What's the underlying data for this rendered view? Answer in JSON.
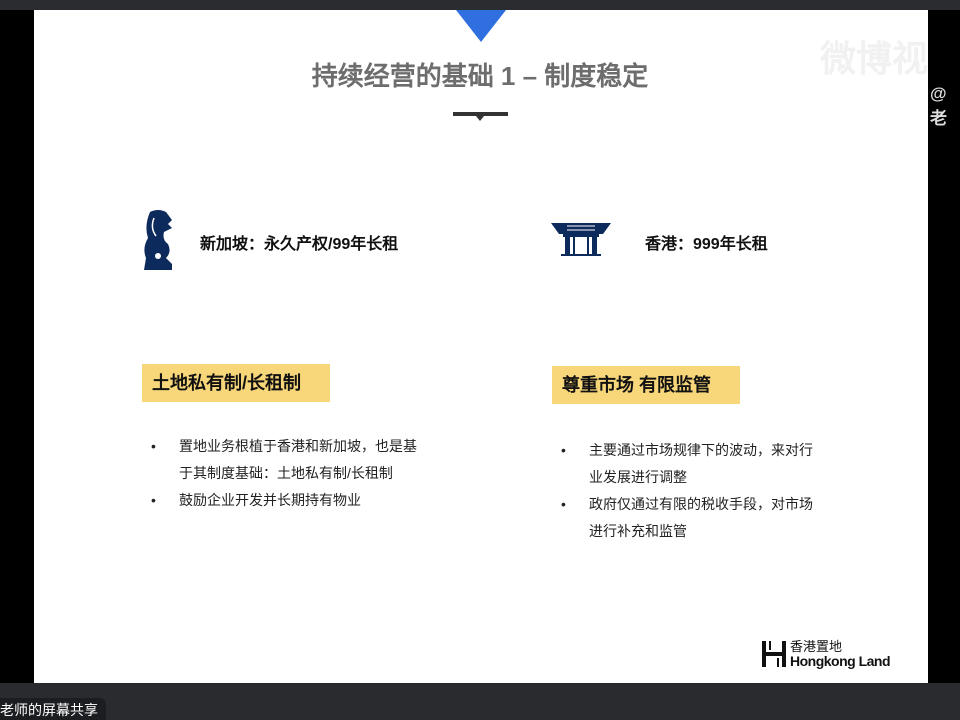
{
  "slide": {
    "title": "持续经营的基础 1 – 制度稳定",
    "singapore_label": "新加坡：永久产权/99年长租",
    "hongkong_label": "香港：999年长租",
    "left_tag": "土地私有制/长租制",
    "right_tag": "尊重市场 有限监管",
    "left_bullets": [
      "置地业务根植于香港和新加坡，也是基于其制度基础：土地私有制/长租制",
      "鼓励企业开发并长期持有物业"
    ],
    "right_bullets": [
      "主要通过市场规律下的波动，来对行业发展进行调整",
      "政府仅通过有限的税收手段，对市场进行补充和监管"
    ],
    "logo_cn": "香港置地",
    "logo_en": "Hongkong Land"
  },
  "watermark": {
    "text": "微博视",
    "handle": "@老"
  },
  "share_label": "老师的屏幕共享",
  "colors": {
    "accent_blue": "#2f6fe0",
    "tag_yellow": "#f8d77a",
    "navy": "#0d2a5c",
    "title_gray": "#6d6d6d"
  }
}
